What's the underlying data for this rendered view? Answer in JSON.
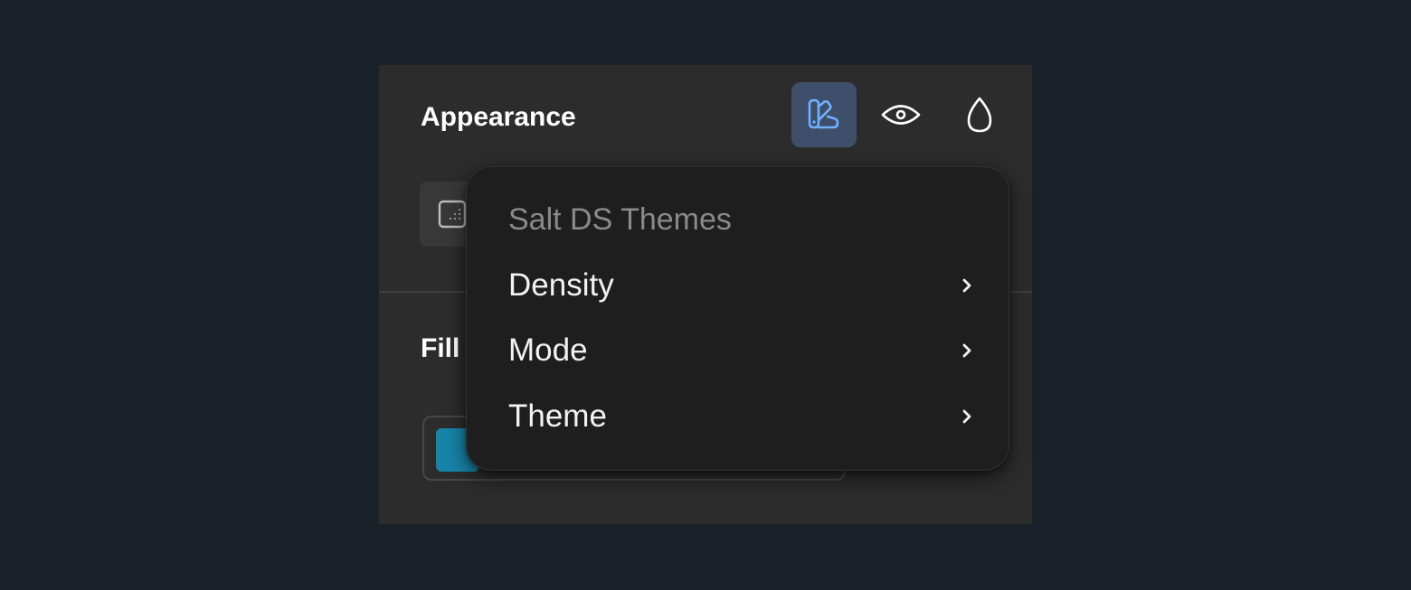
{
  "panel": {
    "title": "Appearance",
    "toolbar": [
      {
        "icon": "themes-icon",
        "active": true
      },
      {
        "icon": "eye-icon",
        "active": false
      },
      {
        "icon": "droplet-icon",
        "active": false
      }
    ],
    "fill_label": "Fill",
    "fill_swatch_color": "#1784a8"
  },
  "menu": {
    "heading": "Salt DS Themes",
    "items": [
      {
        "label": "Density",
        "icon": "chevron-right-icon"
      },
      {
        "label": "Mode",
        "icon": "chevron-right-icon"
      },
      {
        "label": "Theme",
        "icon": "chevron-right-icon"
      }
    ]
  },
  "colors": {
    "background": "#1b2129",
    "panel": "#2c2c2c",
    "menu": "#1e1e1e",
    "active_button": "#3e4e6b",
    "accent_icon": "#6fb2ff",
    "heading_muted": "#8a8a8a"
  }
}
